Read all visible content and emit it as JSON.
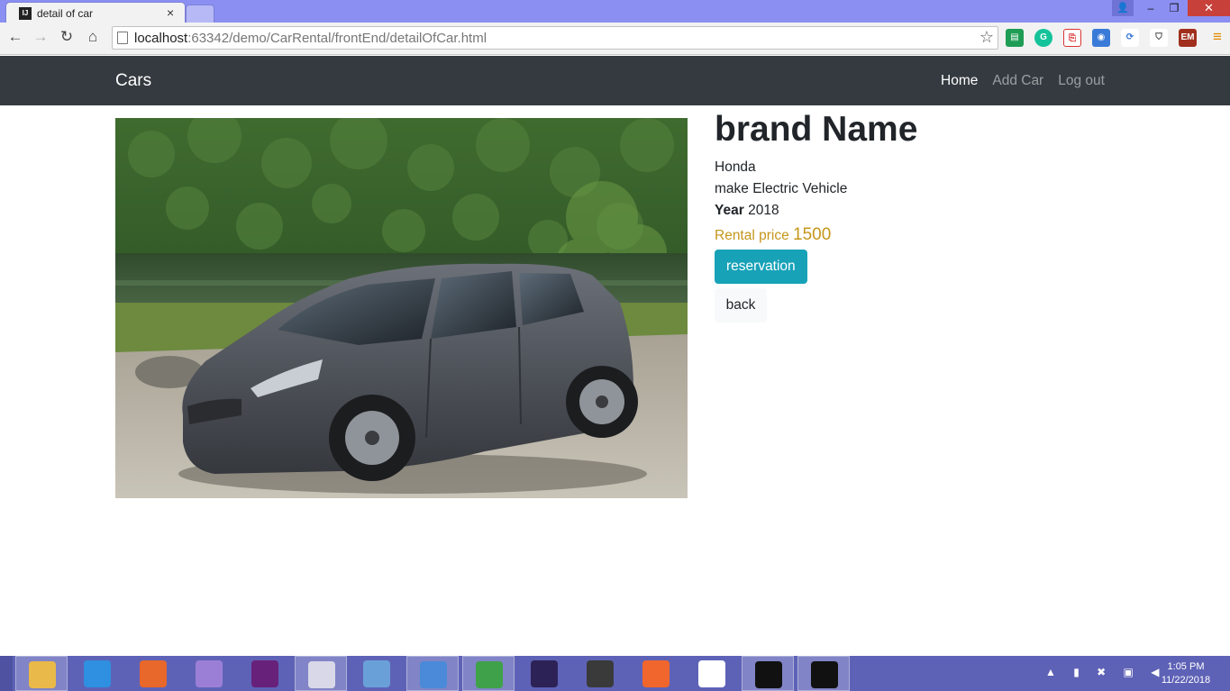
{
  "browser": {
    "tab_title": "detail of car",
    "tab_favicon": "IJ",
    "tab_close": "×",
    "url_host": "localhost",
    "url_rest": ":63342/demo/CarRental/frontEnd/detailOfCar.html",
    "icons": {
      "back": "back-arrow-icon",
      "forward": "forward-arrow-icon",
      "reload": "reload-icon",
      "home": "home-icon",
      "bookmark": "star-icon",
      "menu": "hamburger-menu-icon"
    },
    "extensions": [
      "sheets-icon",
      "grammarly-icon",
      "pdf-icon",
      "screenshot-icon",
      "sync-icon",
      "shield-icon",
      "em-icon"
    ],
    "ext_em_label": "EM"
  },
  "navbar": {
    "brand": "Cars",
    "links": [
      {
        "label": "Home",
        "active": true
      },
      {
        "label": "Add Car",
        "active": false
      },
      {
        "label": "Log out",
        "active": false
      }
    ]
  },
  "car": {
    "title": "brand Name",
    "brand": "Honda",
    "make": "make Electric Vehicle",
    "year_label": "Year",
    "year": "2018",
    "price_label": "Rental price",
    "price": "1500",
    "reserve_label": "reservation",
    "back_label": "back",
    "photo": "gray-honda-fit-hatchback-photo"
  },
  "taskbar": {
    "apps": [
      {
        "icon": "file-explorer-icon",
        "color": "#e9b949"
      },
      {
        "icon": "internet-explorer-icon",
        "color": "#2f8fe0"
      },
      {
        "icon": "firefox-icon",
        "color": "#e8672a"
      },
      {
        "icon": "visual-studio-icon",
        "color": "#9b7fd6"
      },
      {
        "icon": "visual-studio-code-icon",
        "color": "#68217a"
      },
      {
        "icon": "snipping-tool-icon",
        "color": "#d8d8e8"
      },
      {
        "icon": "calculator-icon",
        "color": "#6aa0d8"
      },
      {
        "icon": "chrome-canary-icon",
        "color": "#4a8ad8"
      },
      {
        "icon": "chrome-icon",
        "color": "#3fa14a"
      },
      {
        "icon": "eclipse-icon",
        "color": "#2c2255"
      },
      {
        "icon": "sublime-text-icon",
        "color": "#3a3a3a"
      },
      {
        "icon": "postman-icon",
        "color": "#f0662c"
      },
      {
        "icon": "mongo-compass-icon",
        "color": "#ffffff"
      },
      {
        "icon": "intellij-icon",
        "color": "#111111"
      },
      {
        "icon": "mysql-console-icon",
        "color": "#111111"
      }
    ],
    "time": "1:05 PM",
    "date": "11/22/2018",
    "tray_text": "▲ ▮ ✖ ▣ ◀"
  }
}
